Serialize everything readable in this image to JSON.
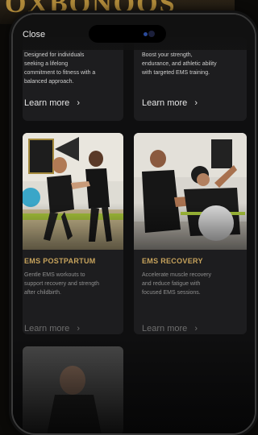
{
  "close_label": "Close",
  "cards": [
    {
      "desc_lines": [
        "Designed for individuals",
        "seeking a lifelong",
        "commitment to fitness with a",
        "balanced approach."
      ],
      "learn_more": "Learn more",
      "arrow": "›"
    },
    {
      "desc_lines": [
        "Boost your strength,",
        "endurance, and athletic ability",
        "with targeted EMS training."
      ],
      "learn_more": "Learn more",
      "arrow": "›"
    },
    {
      "title": "EMS POSTPARTUM",
      "desc_lines": [
        "Gentle EMS workouts to",
        "support recovery and strength",
        "after childbirth."
      ],
      "learn_more": "Learn more",
      "arrow": "›"
    },
    {
      "title": "EMS RECOVERY",
      "desc_lines": [
        "Accelerate muscle recovery",
        "and reduce fatigue with",
        "focused EMS sessions."
      ],
      "learn_more": "Learn more",
      "arrow": "›"
    }
  ],
  "colors": {
    "title_gold": "#c7a35c",
    "card_bg": "#1d1d1f",
    "accent_green": "#a8c53b"
  }
}
